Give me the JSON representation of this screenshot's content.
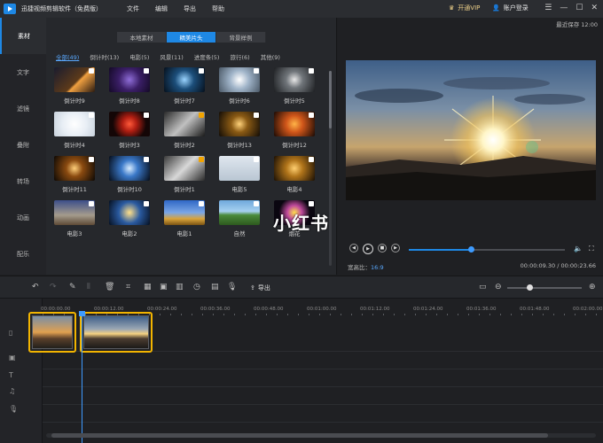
{
  "app": {
    "title": "迅捷视频剪辑软件（免费版）",
    "menu": [
      "文件",
      "编辑",
      "导出",
      "帮助"
    ],
    "vip": "开通VIP",
    "login": "账户登录"
  },
  "sidebar": {
    "items": [
      "素材",
      "文字",
      "滤镜",
      "叠附",
      "转场",
      "动画",
      "配乐"
    ],
    "active": 0
  },
  "library": {
    "sources": [
      "本地素材",
      "精美片头",
      "背景样例"
    ],
    "active_source": 1,
    "categories": [
      "全部(49)",
      "倒计时(13)",
      "电影(5)",
      "风景(11)",
      "进度条(5)",
      "旅行(6)",
      "其他(9)"
    ],
    "active_category": 0,
    "items": [
      {
        "label": "倒计时9",
        "icon": "plus-icon",
        "bg": "linear-gradient(135deg,#1a1c2e,#5d3a1a 55%,#f0a040 60%,#2a1a10)"
      },
      {
        "label": "倒计时8",
        "icon": "plus-icon",
        "bg": "radial-gradient(circle,#8f6dd8 0%,#3a1e66 45%,#140a26 100%)"
      },
      {
        "label": "倒计时7",
        "icon": "plus-icon",
        "bg": "radial-gradient(circle,#9ad4ff 0%,#1c4e7a 40%,#06101c 100%)"
      },
      {
        "label": "倒计时6",
        "icon": "plus-icon",
        "bg": "radial-gradient(circle,#ffffff 0%,#9fb3c8 40%,#4a5866 100%)"
      },
      {
        "label": "倒计时5",
        "icon": "plus-icon",
        "bg": "radial-gradient(circle,#e8e8e8 0%,#70757a 35%,#1d1f22 100%)"
      },
      {
        "label": "倒计时4",
        "icon": "plus-icon",
        "bg": "radial-gradient(circle,#ffffff 0%,#e8eef5 50%,#c8d2dc 100%)"
      },
      {
        "label": "倒计时3",
        "icon": "plus-icon",
        "bg": "radial-gradient(circle,#ff5a3a 0%,#b01e12 30%,#140606 70%)"
      },
      {
        "label": "倒计时2",
        "icon": "crown-icon",
        "bg": "linear-gradient(135deg,#2a2a2a,#c0c0c0 50%,#1a1a1a)"
      },
      {
        "label": "倒计时13",
        "icon": "plus-icon",
        "bg": "radial-gradient(circle,#ffd27a 0%,#8a5a14 35%,#120c06 100%)"
      },
      {
        "label": "倒计时12",
        "icon": "plus-icon",
        "bg": "radial-gradient(circle,#ffb347 0%,#d0561a 35%,#1a0a04 100%)"
      },
      {
        "label": "倒计时11",
        "icon": "plus-icon",
        "bg": "radial-gradient(circle,#ffcf7a 0%,#8a4a10 35%,#0c0804 100%)"
      },
      {
        "label": "倒计时10",
        "icon": "plus-icon",
        "bg": "radial-gradient(circle,#d8ecff 0%,#3a78c8 35%,#050c18 100%)"
      },
      {
        "label": "倒计时1",
        "icon": "crown-icon",
        "bg": "linear-gradient(135deg,#3a3a3a,#d8d8d8 50%,#2a2a2a)"
      },
      {
        "label": "电影5",
        "icon": "plus-icon",
        "bg": "linear-gradient(#dfe6ee,#b9c6d3)"
      },
      {
        "label": "电影4",
        "icon": "plus-icon",
        "bg": "radial-gradient(circle,#ffcf70 0%,#b0741a 35%,#1a0f04 100%)"
      },
      {
        "label": "电影3",
        "icon": "plus-icon",
        "bg": "linear-gradient(#3c4e8a,#a49b8c 60%,#5e4a36)"
      },
      {
        "label": "电影2",
        "icon": "plus-icon",
        "bg": "radial-gradient(circle,#ffe08a 0%,#2a5aa0 45%,#061020 100%)"
      },
      {
        "label": "电影1",
        "icon": "plus-icon",
        "bg": "linear-gradient(#2f67c6,#7aa6e6 50%,#d9a43a 75%,#7a5214)"
      },
      {
        "label": "自然",
        "icon": "plus-icon",
        "bg": "linear-gradient(#6fa8dc,#a6d1f0 45%,#4a8a3a 60%,#2d5a1e)"
      },
      {
        "label": "烟花",
        "icon": "plus-icon",
        "bg": "radial-gradient(circle,#ffe14d 0%,#c04a9c 30%,#0a0610 65%)"
      }
    ]
  },
  "preview": {
    "autosave": "最近保存 12:00",
    "ratio_label": "宽高比：",
    "ratio_value": "16:9",
    "timecode": "00:00:09.30 / 00:00:23.66",
    "progress": 0.4
  },
  "watermark": "小红书",
  "toolbar": {
    "export": "导出"
  },
  "timeline": {
    "ticks": [
      "00:00:00.00",
      "00:00:12.00",
      "00:00:24.00",
      "00:00:36.00",
      "00:00:48.00",
      "00:01:00.00",
      "00:01:12.00",
      "00:01:24.00",
      "00:01:36.00",
      "00:01:48.00",
      "00:02:00.00"
    ]
  }
}
